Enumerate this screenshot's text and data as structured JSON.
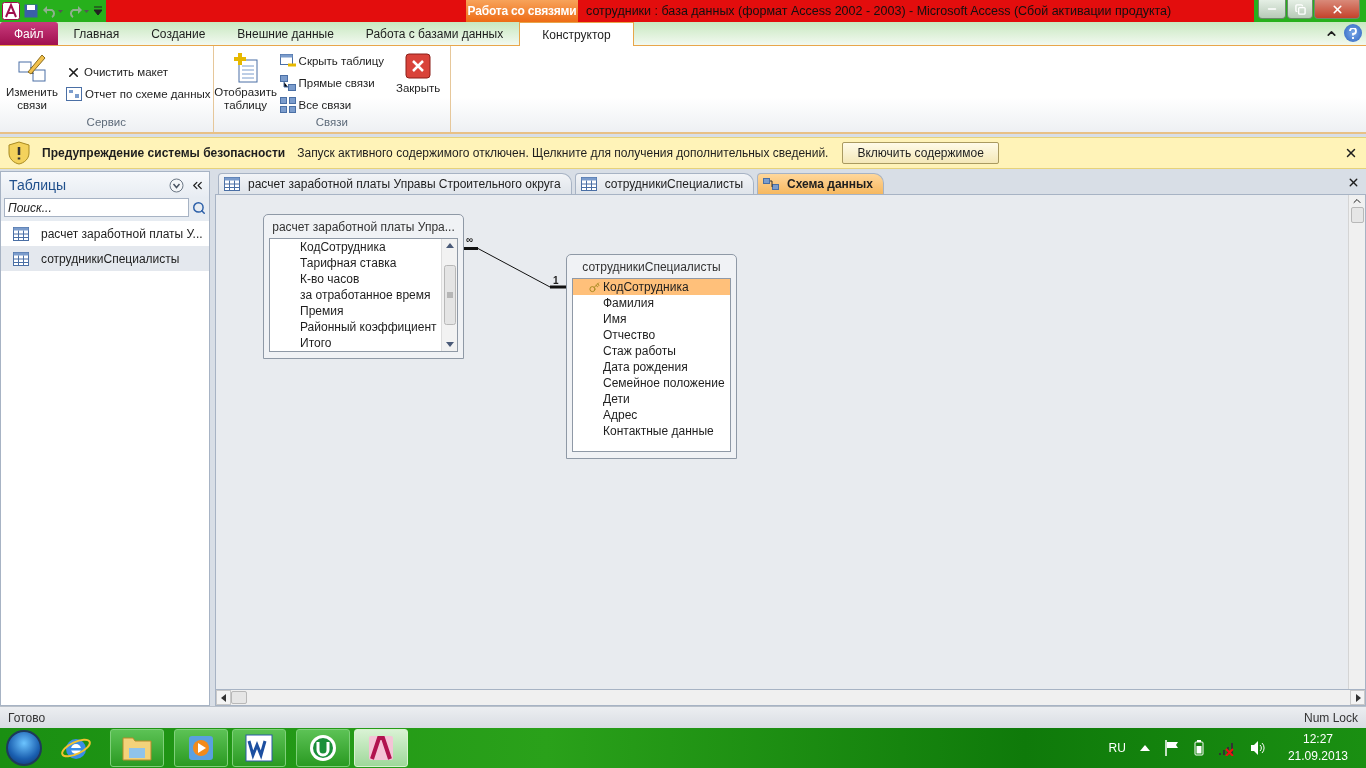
{
  "window": {
    "title": "сотрудники : база данных (формат Access 2002 - 2003)  -  Microsoft Access (Сбой активации продукта)",
    "context_group": "Работа со связями"
  },
  "ribbon_tabs": [
    {
      "label": "Файл",
      "kind": "file",
      "selected": false
    },
    {
      "label": "Главная",
      "kind": "normal",
      "selected": false
    },
    {
      "label": "Создание",
      "kind": "normal",
      "selected": false
    },
    {
      "label": "Внешние данные",
      "kind": "normal",
      "selected": false
    },
    {
      "label": "Работа с базами данных",
      "kind": "normal",
      "selected": false
    },
    {
      "label": "Конструктор",
      "kind": "context",
      "selected": true
    }
  ],
  "ribbon_groups": [
    {
      "label": "Сервис",
      "controls": [
        {
          "kind": "large",
          "label": "Изменить связи"
        },
        {
          "kind": "stack",
          "items": [
            "Очистить макет",
            "Отчет по схеме данных"
          ]
        }
      ]
    },
    {
      "label": "Связи",
      "controls": [
        {
          "kind": "large",
          "label": "Отобразить таблицу"
        },
        {
          "kind": "stack",
          "items": [
            "Скрыть таблицу",
            "Прямые связи",
            "Все связи"
          ]
        },
        {
          "kind": "large",
          "label": "Закрыть"
        }
      ]
    }
  ],
  "security_bar": {
    "title": "Предупреждение системы безопасности",
    "message": "Запуск активного содержимого отключен. Щелкните для получения дополнительных сведений.",
    "button": "Включить содержимое"
  },
  "navigation": {
    "title": "Таблицы",
    "search": {
      "placeholder": "Поиск..."
    },
    "items": [
      {
        "label": "расчет заработной платы У...",
        "selected": false
      },
      {
        "label": "сотрудникиСпециалисты",
        "selected": true
      }
    ]
  },
  "document_tabs": [
    {
      "label": "расчет заработной платы Управы Строительного округа",
      "kind": "table",
      "selected": false
    },
    {
      "label": "сотрудникиСпециалисты",
      "kind": "table",
      "selected": false
    },
    {
      "label": "Схема данных",
      "kind": "diagram",
      "selected": true
    }
  ],
  "diagram": {
    "tables": [
      {
        "title": "расчет заработной платы Упра...",
        "scrollable": true,
        "fields": [
          {
            "name": "КодСотрудника",
            "primary_key": false,
            "selected": false
          },
          {
            "name": "Тарифная ставка",
            "primary_key": false,
            "selected": false
          },
          {
            "name": "К-во часов",
            "primary_key": false,
            "selected": false
          },
          {
            "name": "за отработанное время",
            "primary_key": false,
            "selected": false
          },
          {
            "name": "Премия",
            "primary_key": false,
            "selected": false
          },
          {
            "name": "Районный коэффициент",
            "primary_key": false,
            "selected": false
          },
          {
            "name": "Итого",
            "primary_key": false,
            "selected": false
          }
        ]
      },
      {
        "title": "сотрудникиСпециалисты",
        "scrollable": false,
        "fields": [
          {
            "name": "КодСотрудника",
            "primary_key": true,
            "selected": true
          },
          {
            "name": "Фамилия",
            "primary_key": false,
            "selected": false
          },
          {
            "name": "Имя",
            "primary_key": false,
            "selected": false
          },
          {
            "name": "Отчество",
            "primary_key": false,
            "selected": false
          },
          {
            "name": "Стаж работы",
            "primary_key": false,
            "selected": false
          },
          {
            "name": "Дата рождения",
            "primary_key": false,
            "selected": false
          },
          {
            "name": "Семейное положение",
            "primary_key": false,
            "selected": false
          },
          {
            "name": "Дети",
            "primary_key": false,
            "selected": false
          },
          {
            "name": "Адрес",
            "primary_key": false,
            "selected": false
          },
          {
            "name": "Контактные данные",
            "primary_key": false,
            "selected": false
          }
        ]
      }
    ],
    "relationship": {
      "many_label": "∞",
      "one_label": "1"
    }
  },
  "status_bar": {
    "left": "Готово",
    "right": "Num Lock"
  },
  "taskbar": {
    "apps": [
      {
        "selected": false
      },
      {
        "selected": false
      },
      {
        "selected": false
      },
      {
        "selected": false
      },
      {
        "selected": true
      }
    ],
    "language": "RU",
    "time": "12:27",
    "date": "21.09.2013"
  }
}
